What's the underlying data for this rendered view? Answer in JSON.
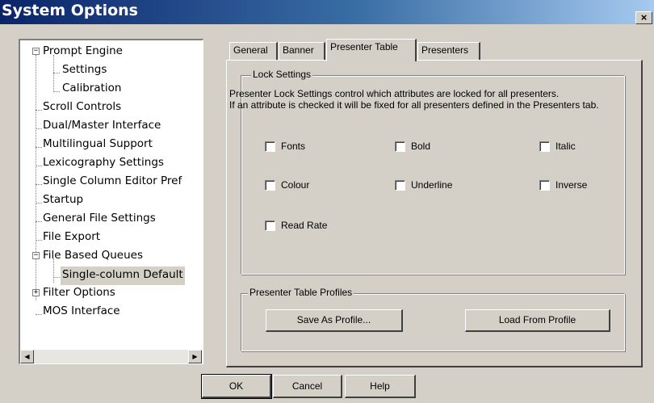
{
  "window": {
    "title": "System Options",
    "close_glyph": "×"
  },
  "tree": {
    "items": [
      {
        "label": "Prompt Engine",
        "expander": "−"
      },
      {
        "label": "Settings"
      },
      {
        "label": "Calibration"
      },
      {
        "label": "Scroll Controls"
      },
      {
        "label": "Dual/Master Interface"
      },
      {
        "label": "Multilingual Support"
      },
      {
        "label": "Lexicography Settings"
      },
      {
        "label": "Single Column Editor Pref"
      },
      {
        "label": "Startup"
      },
      {
        "label": "General File Settings"
      },
      {
        "label": "File Export"
      },
      {
        "label": "File Based Queues",
        "expander": "−"
      },
      {
        "label": "Single-column Default",
        "selected": true
      },
      {
        "label": "Filter Options",
        "expander": "+"
      },
      {
        "label": "MOS Interface"
      }
    ],
    "scroll_left_glyph": "◀",
    "scroll_right_glyph": "▶"
  },
  "tabs": [
    {
      "label": "General"
    },
    {
      "label": "Banner"
    },
    {
      "label": "Presenter Table",
      "active": true
    },
    {
      "label": "Presenters"
    }
  ],
  "lock_settings": {
    "legend": "Lock Settings",
    "description": "Presenter Lock Settings control which attributes are locked for all presenters.\n If an attribute is checked it will be fixed for all presenters defined in the Presenters tab.",
    "checkboxes": [
      {
        "label": "Fonts",
        "checked": false
      },
      {
        "label": "Bold",
        "checked": false
      },
      {
        "label": "Italic",
        "checked": false
      },
      {
        "label": "Colour",
        "checked": false
      },
      {
        "label": "Underline",
        "checked": false
      },
      {
        "label": "Inverse",
        "checked": false
      },
      {
        "label": "Read Rate",
        "checked": false
      }
    ]
  },
  "profiles": {
    "legend": "Presenter Table Profiles",
    "save_label": "Save As Profile...",
    "load_label": "Load From Profile"
  },
  "footer": {
    "ok_label": "OK",
    "cancel_label": "Cancel",
    "help_label": "Help"
  },
  "colors": {
    "title_bar_start": "#0a246a",
    "title_bar_end": "#a6caf0",
    "face": "#d4d0c8"
  }
}
